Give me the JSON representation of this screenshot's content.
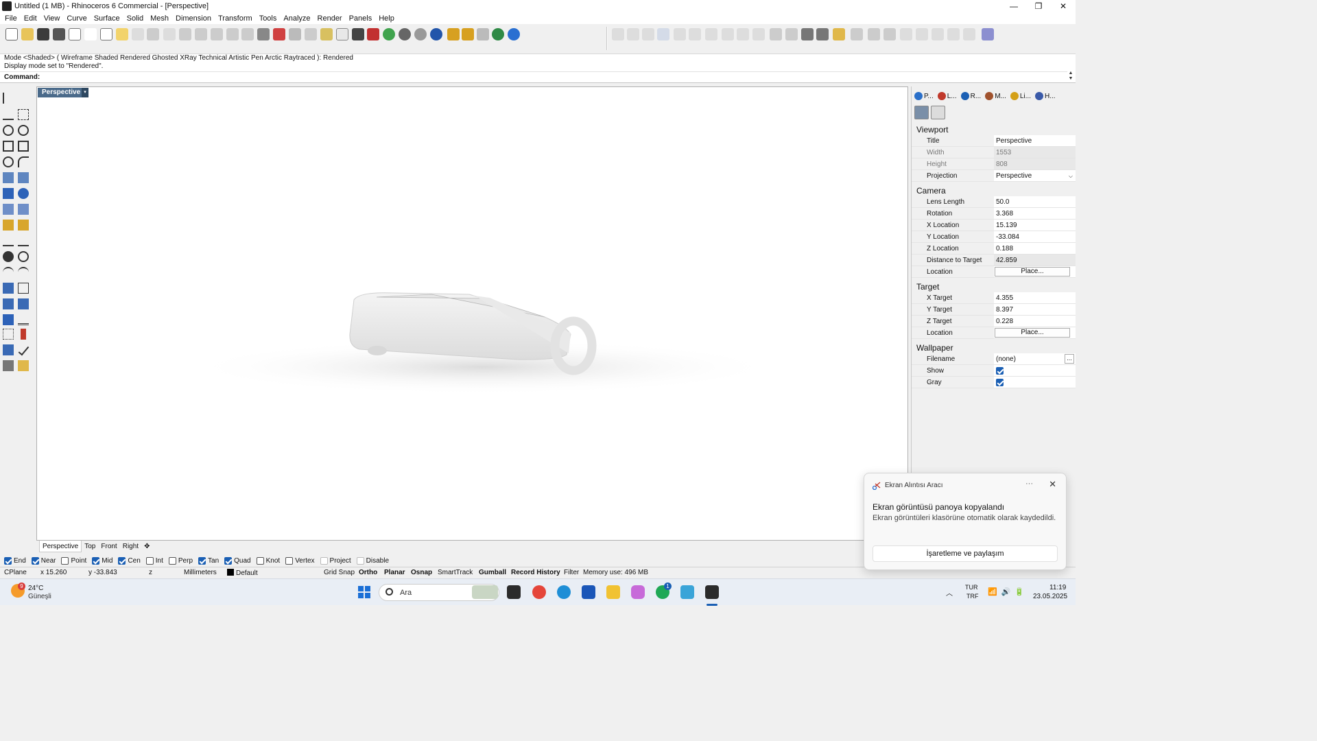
{
  "window": {
    "title": "Untitled (1 MB) - Rhinoceros 6 Commercial - [Perspective]",
    "minimize": "—",
    "maximize": "❐",
    "close": "✕"
  },
  "menu": [
    "File",
    "Edit",
    "View",
    "Curve",
    "Surface",
    "Solid",
    "Mesh",
    "Dimension",
    "Transform",
    "Tools",
    "Analyze",
    "Render",
    "Panels",
    "Help"
  ],
  "command": {
    "history_line1": "Mode <Shaded> ( Wireframe Shaded Rendered Ghosted XRay Technical Artistic Pen Arctic Raytraced ): Rendered",
    "history_line2": "Display mode set to \"Rendered\".",
    "prompt": "Command:",
    "value": ""
  },
  "viewport": {
    "title": "Perspective",
    "menu_arrow": "▾"
  },
  "viewport_tabs": [
    "Perspective",
    "Top",
    "Front",
    "Right"
  ],
  "viewport_tab_add": "✥",
  "osnap": [
    {
      "label": "End",
      "checked": true
    },
    {
      "label": "Near",
      "checked": true
    },
    {
      "label": "Point",
      "checked": false
    },
    {
      "label": "Mid",
      "checked": true
    },
    {
      "label": "Cen",
      "checked": true
    },
    {
      "label": "Int",
      "checked": false
    },
    {
      "label": "Perp",
      "checked": false
    },
    {
      "label": "Tan",
      "checked": true
    },
    {
      "label": "Quad",
      "checked": true
    },
    {
      "label": "Knot",
      "checked": false
    },
    {
      "label": "Vertex",
      "checked": false
    },
    {
      "label": "Project",
      "checked": false
    },
    {
      "label": "Disable",
      "checked": false
    }
  ],
  "status": {
    "cplane": "CPlane",
    "x": "x 15.260",
    "y": "y -33.843",
    "z": "z",
    "units": "Millimeters",
    "layer": "Default",
    "grid_snap": "Grid Snap",
    "ortho": "Ortho",
    "planar": "Planar",
    "osnap": "Osnap",
    "smarttrack": "SmartTrack",
    "gumball": "Gumball",
    "record_history": "Record History",
    "filter": "Filter",
    "memory": "Memory use: 496 MB"
  },
  "panel": {
    "tabs": [
      {
        "label": "P...",
        "color": "#2a6fc9"
      },
      {
        "label": "L...",
        "color": "#c0392b"
      },
      {
        "label": "R...",
        "color": "#1a5fb4"
      },
      {
        "label": "M...",
        "color": "#a0522d"
      },
      {
        "label": "Li...",
        "color": "#d4a017"
      },
      {
        "label": "H...",
        "color": "#3a5aa8"
      }
    ],
    "viewport_section": "Viewport",
    "title_label": "Title",
    "title_value": "Perspective",
    "width_label": "Width",
    "width_value": "1553",
    "height_label": "Height",
    "height_value": "808",
    "projection_label": "Projection",
    "projection_value": "Perspective",
    "camera_section": "Camera",
    "lens_label": "Lens Length",
    "lens_value": "50.0",
    "rotation_label": "Rotation",
    "rotation_value": "3.368",
    "xloc_label": "X Location",
    "xloc_value": "15.139",
    "yloc_label": "Y Location",
    "yloc_value": "-33.084",
    "zloc_label": "Z Location",
    "zloc_value": "0.188",
    "dist_label": "Distance to Target",
    "dist_value": "42.859",
    "location_label": "Location",
    "place_label": "Place...",
    "target_section": "Target",
    "xt_label": "X Target",
    "xt_value": "4.355",
    "yt_label": "Y Target",
    "yt_value": "8.397",
    "zt_label": "Z Target",
    "zt_value": "0.228",
    "tlocation_label": "Location",
    "tplace_label": "Place...",
    "wallpaper_section": "Wallpaper",
    "filename_label": "Filename",
    "filename_value": "(none)",
    "filename_btn": "...",
    "show_label": "Show",
    "show_checked": true,
    "gray_label": "Gray",
    "gray_checked": true
  },
  "toast": {
    "app": "Ekran Alıntısı Aracı",
    "more": "···",
    "close": "✕",
    "title": "Ekran görüntüsü panoya kopyalandı",
    "body": "Ekran görüntüleri klasörüne otomatik olarak kaydedildi.",
    "action": "İşaretleme ve paylaşım"
  },
  "taskbar": {
    "weather_badge": "9",
    "weather_temp": "24°C",
    "weather_desc": "Güneşli",
    "search_label": "Ara",
    "whatsapp_badge": "1",
    "chevron": "︿",
    "lang1": "TUR",
    "lang2": "TRF",
    "tray_icons": "📶🔊🔋",
    "time": "11:19",
    "date": "23.05.2025"
  }
}
